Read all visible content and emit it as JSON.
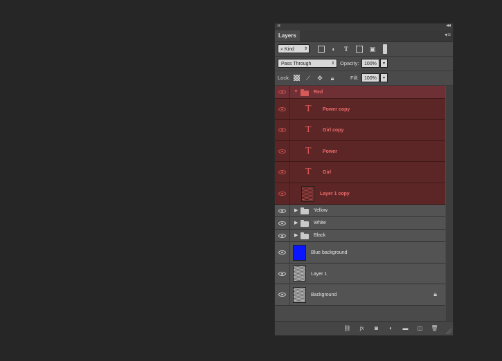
{
  "panel": {
    "tab_label": "Layers",
    "close_glyph": "×",
    "collapse_glyph": "◂◂",
    "menu_glyph": "▾≡"
  },
  "filter": {
    "kind_label": "Kind",
    "icons": [
      "image-filter-icon",
      "adjustment-filter-icon",
      "type-filter-icon",
      "shape-filter-icon",
      "smart-object-filter-icon",
      "filter-toggle-icon"
    ]
  },
  "blending": {
    "mode": "Pass Through",
    "opacity_label": "Opacity:",
    "opacity_value": "100%"
  },
  "lock": {
    "label": "Lock:",
    "fill_label": "Fill:",
    "fill_value": "100%"
  },
  "layers": [
    {
      "name": "Red",
      "kind": "group",
      "expanded": true,
      "color": "red"
    },
    {
      "name": "Power copy",
      "kind": "type",
      "color": "red"
    },
    {
      "name": "Girl copy",
      "kind": "type",
      "color": "red"
    },
    {
      "name": "Power",
      "kind": "type",
      "color": "red"
    },
    {
      "name": "Girl",
      "kind": "type",
      "color": "red"
    },
    {
      "name": "Layer 1 copy",
      "kind": "pixel",
      "color": "red"
    },
    {
      "name": "Yellow",
      "kind": "group",
      "expanded": false
    },
    {
      "name": "White",
      "kind": "group",
      "expanded": false
    },
    {
      "name": "Black",
      "kind": "group",
      "expanded": false
    },
    {
      "name": "Blue background",
      "kind": "fill",
      "fill_color": "#0a16ff"
    },
    {
      "name": "Layer 1",
      "kind": "pixel"
    },
    {
      "name": "Background",
      "kind": "pixel",
      "locked": true
    }
  ],
  "type_glyph": "T",
  "footer_icons": [
    "link-layers-icon",
    "fx-icon",
    "add-mask-icon",
    "adjustment-layer-icon",
    "new-group-icon",
    "new-layer-icon",
    "delete-layer-icon"
  ]
}
